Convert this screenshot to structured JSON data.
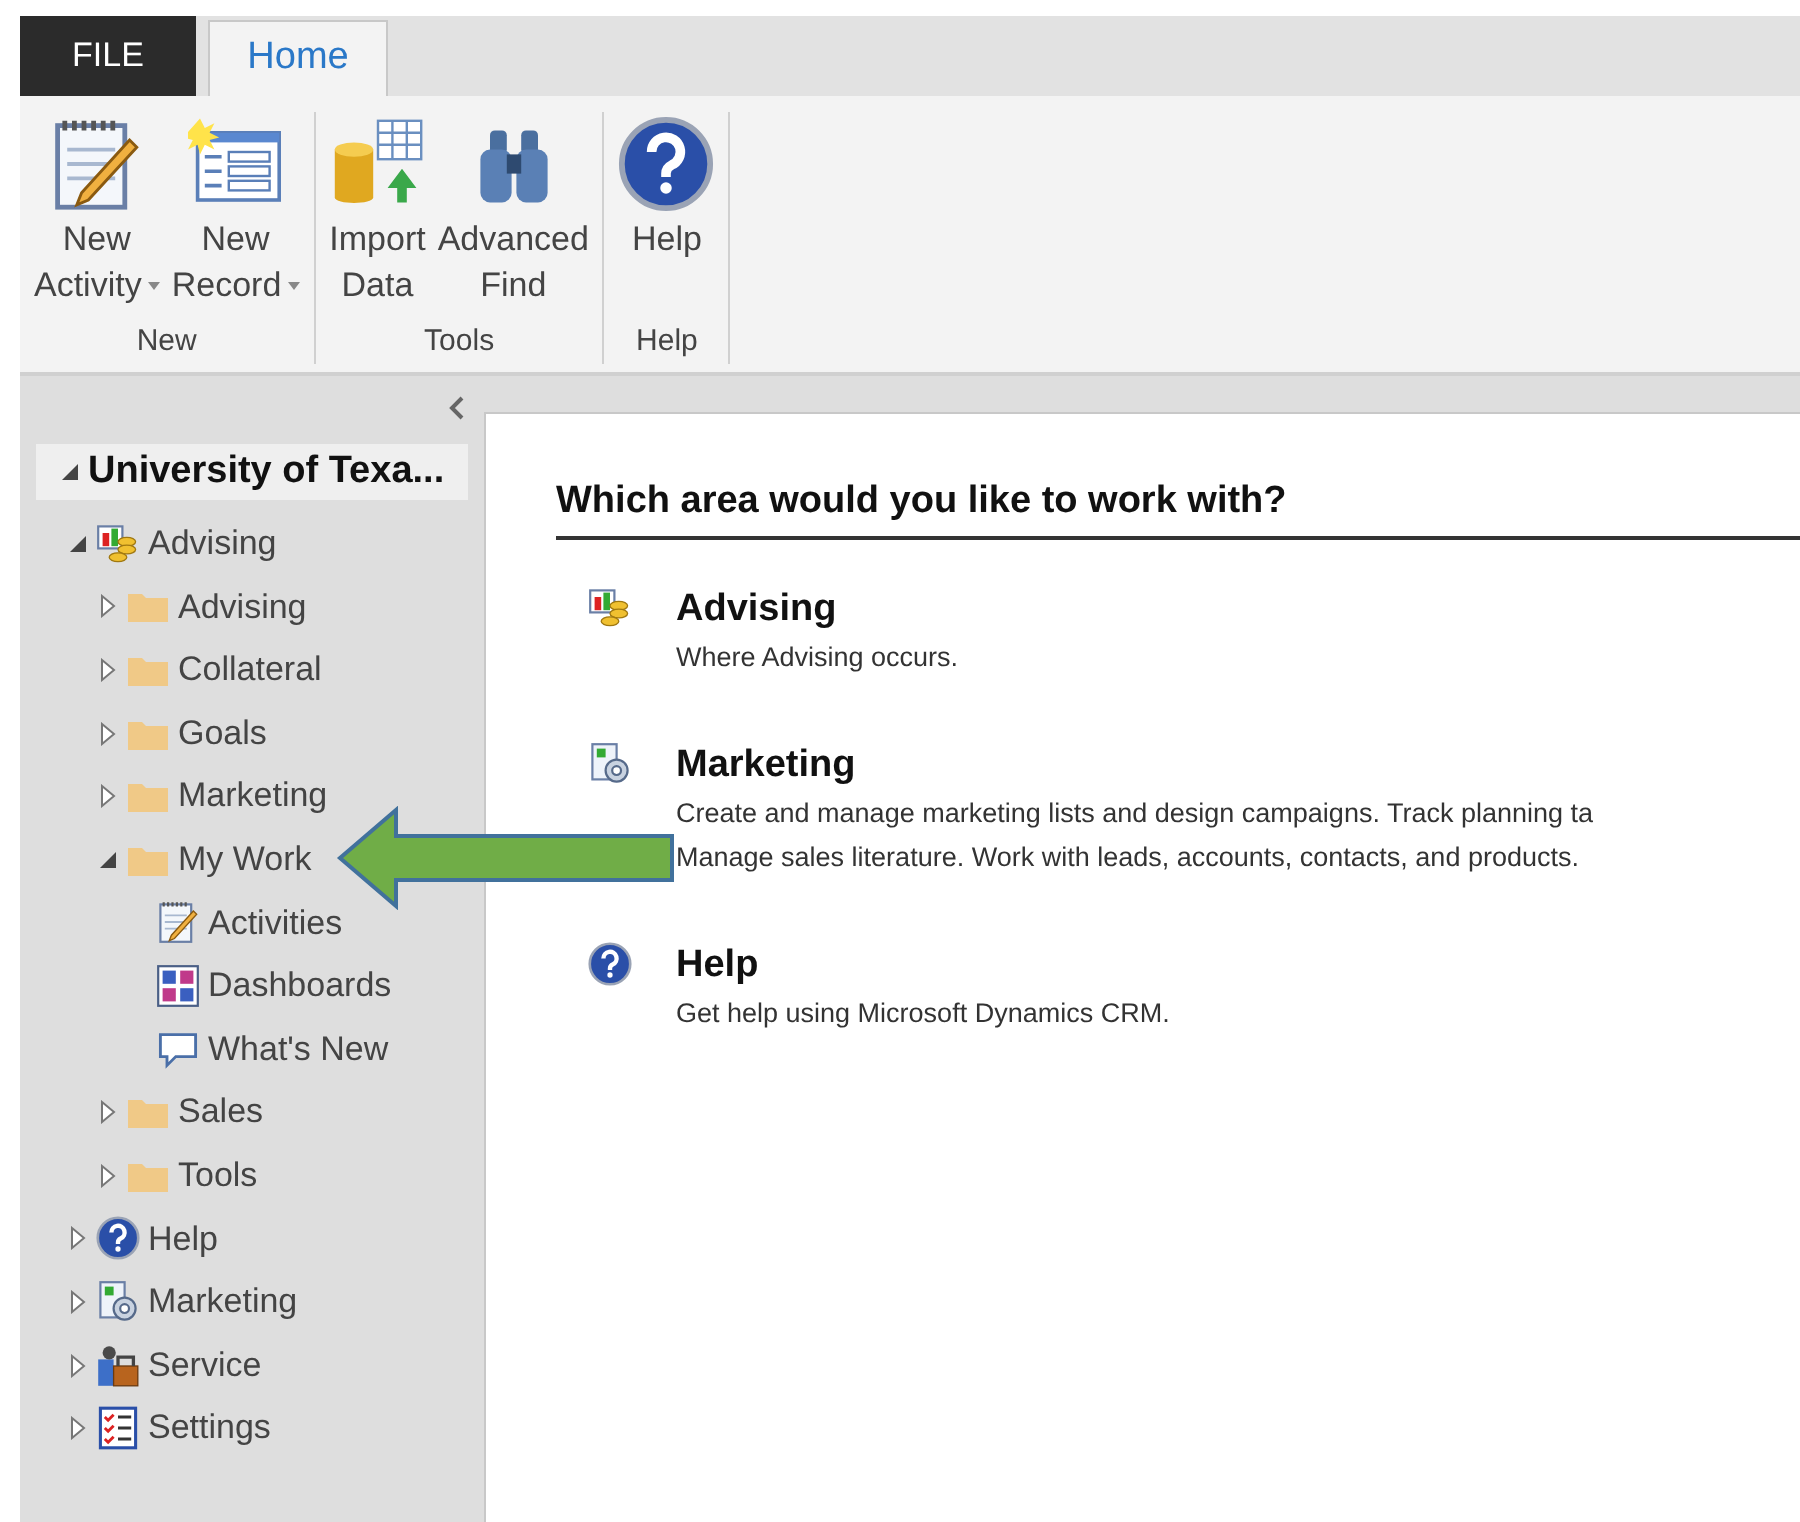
{
  "tabs": [
    {
      "label": "FILE",
      "kind": "file",
      "selected": false
    },
    {
      "label": "Home",
      "kind": "tab",
      "selected": true
    }
  ],
  "ribbon": [
    {
      "label": "New",
      "buttons": [
        {
          "lines": [
            "New",
            "Activity"
          ],
          "dropdown": true
        },
        {
          "lines": [
            "New",
            "Record"
          ],
          "dropdown": true
        }
      ]
    },
    {
      "label": "Tools",
      "buttons": [
        {
          "lines": [
            "Import",
            "Data"
          ],
          "dropdown": false
        },
        {
          "lines": [
            "Advanced",
            "Find"
          ],
          "dropdown": false
        }
      ]
    },
    {
      "label": "Help",
      "buttons": [
        {
          "lines": [
            "Help"
          ],
          "dropdown": false
        }
      ]
    }
  ],
  "sidebar": {
    "root": {
      "label": "University of Texa...",
      "expanded": true
    },
    "items": [
      {
        "label": "Advising",
        "kind": "area",
        "expanded": true,
        "children": [
          {
            "label": "Advising",
            "kind": "folder",
            "expanded": false
          },
          {
            "label": "Collateral",
            "kind": "folder",
            "expanded": false
          },
          {
            "label": "Goals",
            "kind": "folder",
            "expanded": false
          },
          {
            "label": "Marketing",
            "kind": "folder",
            "expanded": false
          },
          {
            "label": "My Work",
            "kind": "folder",
            "expanded": true,
            "children": [
              {
                "label": "Activities",
                "kind": "page"
              },
              {
                "label": "Dashboards",
                "kind": "page"
              },
              {
                "label": "What's New",
                "kind": "page"
              }
            ]
          },
          {
            "label": "Sales",
            "kind": "folder",
            "expanded": false
          },
          {
            "label": "Tools",
            "kind": "folder",
            "expanded": false
          }
        ]
      },
      {
        "label": "Help",
        "kind": "area",
        "expanded": false
      },
      {
        "label": "Marketing",
        "kind": "area",
        "expanded": false
      },
      {
        "label": "Service",
        "kind": "area",
        "expanded": false
      },
      {
        "label": "Settings",
        "kind": "area",
        "expanded": false
      }
    ]
  },
  "main": {
    "heading": "Which area would you like to work with?",
    "areas": [
      {
        "title": "Advising",
        "lines": [
          "Where Advising occurs."
        ]
      },
      {
        "title": "Marketing",
        "lines": [
          "Create and manage marketing lists and design campaigns. Track planning ta",
          "Manage sales literature. Work with leads, accounts, contacts, and products."
        ]
      },
      {
        "title": "Help",
        "lines": [
          "Get help using Microsoft Dynamics CRM."
        ]
      }
    ]
  }
}
